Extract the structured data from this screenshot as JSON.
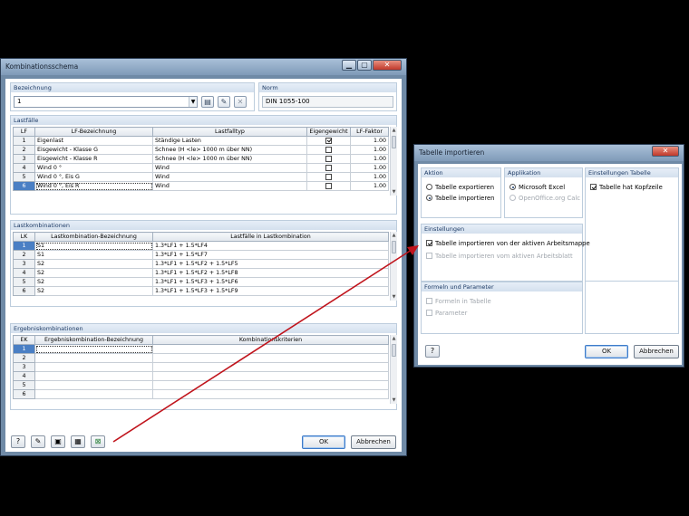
{
  "main": {
    "title": "Kombinationsschema",
    "bezeichnung": {
      "label": "Bezeichnung",
      "value": "1"
    },
    "norm": {
      "label": "Norm",
      "value": "DIN 1055-100"
    },
    "lastfaelle": {
      "label": "Lastfälle",
      "headers": [
        "LF",
        "LF-Bezeichnung",
        "Lastfalltyp",
        "Eigengewicht",
        "LF-Faktor"
      ],
      "rows": [
        {
          "n": "1",
          "name": "Eigenlast",
          "typ": "Ständige Lasten",
          "eigen": true,
          "faktor": "1.00"
        },
        {
          "n": "2",
          "name": "Eisgewicht - Klasse G",
          "typ": "Schnee (H <le> 1000 m über NN)",
          "eigen": false,
          "faktor": "1.00"
        },
        {
          "n": "3",
          "name": "Eisgewicht - Klasse R",
          "typ": "Schnee (H <le> 1000 m über NN)",
          "eigen": false,
          "faktor": "1.00"
        },
        {
          "n": "4",
          "name": "Wind 0 °",
          "typ": "Wind",
          "eigen": false,
          "faktor": "1.00"
        },
        {
          "n": "5",
          "name": "Wind 0 °, Eis G",
          "typ": "Wind",
          "eigen": false,
          "faktor": "1.00"
        },
        {
          "n": "6",
          "name": "Wind 0 °, Eis R",
          "typ": "Wind",
          "eigen": false,
          "faktor": "1.00"
        }
      ]
    },
    "lastkombinationen": {
      "label": "Lastkombinationen",
      "headers": [
        "LK",
        "Lastkombination-Bezeichnung",
        "Lastfälle in Lastkombination"
      ],
      "rows": [
        {
          "n": "1",
          "name": "S1",
          "lf": "1.3*LF1 + 1.5*LF4"
        },
        {
          "n": "2",
          "name": "S1",
          "lf": "1.3*LF1 + 1.5*LF7"
        },
        {
          "n": "3",
          "name": "S2",
          "lf": "1.3*LF1 + 1.5*LF2 + 1.5*LF5"
        },
        {
          "n": "4",
          "name": "S2",
          "lf": "1.3*LF1 + 1.5*LF2 + 1.5*LF8"
        },
        {
          "n": "5",
          "name": "S2",
          "lf": "1.3*LF1 + 1.5*LF3 + 1.5*LF6"
        },
        {
          "n": "6",
          "name": "S2",
          "lf": "1.3*LF1 + 1.5*LF3 + 1.5*LF9"
        }
      ]
    },
    "ergebniskombinationen": {
      "label": "Ergebniskombinationen",
      "headers": [
        "EK",
        "Ergebniskombination-Bezeichnung",
        "Kombinationskriterien"
      ],
      "rows": [
        "1",
        "2",
        "3",
        "4",
        "5",
        "6"
      ]
    },
    "ok_label": "OK",
    "cancel_label": "Abbrechen"
  },
  "dialog": {
    "title": "Tabelle importieren",
    "aktion": {
      "label": "Aktion",
      "options": [
        "Tabelle exportieren",
        "Tabelle importieren"
      ],
      "selected": 1
    },
    "applikation": {
      "label": "Applikation",
      "options": [
        "Microsoft Excel",
        "OpenOffice.org Calc"
      ],
      "selected": 0
    },
    "einstellungen_tabelle": {
      "label": "Einstellungen Tabelle",
      "kopfzeile": "Tabelle hat Kopfzeile"
    },
    "einstellungen": {
      "label": "Einstellungen",
      "aktive_mappe": "Tabelle importieren von der aktiven Arbeitsmappe",
      "aktives_blatt": "Tabelle importieren vom aktiven Arbeitsblatt"
    },
    "formeln": {
      "label": "Formeln und Parameter",
      "formeln": "Formeln in Tabelle",
      "parameter": "Parameter"
    },
    "ok_label": "OK",
    "cancel_label": "Abbrechen"
  },
  "annotation": {
    "arrow_color": "#c0141c"
  }
}
